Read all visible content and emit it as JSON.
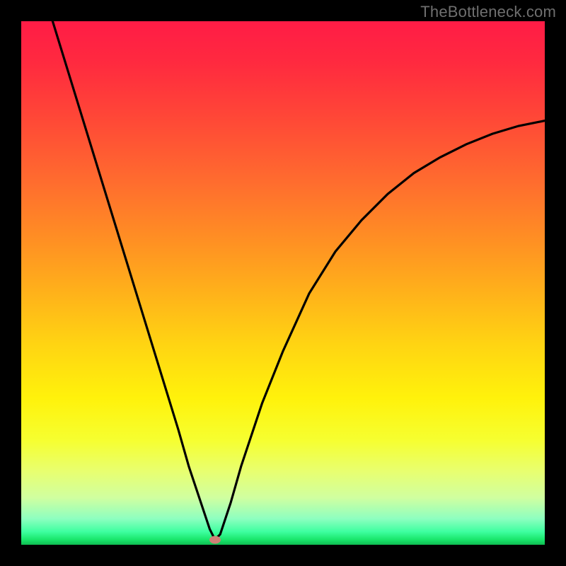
{
  "watermark": "TheBottleneck.com",
  "colors": {
    "frame": "#000000",
    "curve": "#000000",
    "marker": "#cf8076",
    "watermark": "#6f6f6f"
  },
  "chart_data": {
    "type": "line",
    "title": "",
    "xlabel": "",
    "ylabel": "",
    "xlim": [
      0,
      100
    ],
    "ylim": [
      0,
      100
    ],
    "grid": false,
    "legend": false,
    "series": [
      {
        "name": "bottleneck-curve",
        "x": [
          6,
          10,
          14,
          18,
          22,
          26,
          30,
          32,
          34,
          36,
          37,
          38,
          40,
          42,
          46,
          50,
          55,
          60,
          65,
          70,
          75,
          80,
          85,
          90,
          95,
          100
        ],
        "values": [
          100,
          87,
          74,
          61,
          48,
          35,
          22,
          15,
          9,
          3,
          1,
          2,
          8,
          15,
          27,
          37,
          48,
          56,
          62,
          67,
          71,
          74,
          76.5,
          78.5,
          80,
          81
        ]
      }
    ],
    "annotations": [
      {
        "name": "optimum-marker",
        "x": 37,
        "y": 1
      }
    ],
    "background_gradient": {
      "orientation": "vertical",
      "stops": [
        {
          "pos": 0.0,
          "color": "#ff1c46"
        },
        {
          "pos": 0.3,
          "color": "#ff6a2f"
        },
        {
          "pos": 0.62,
          "color": "#ffd512"
        },
        {
          "pos": 0.86,
          "color": "#e8ff70"
        },
        {
          "pos": 1.0,
          "color": "#0fbd52"
        }
      ]
    }
  }
}
